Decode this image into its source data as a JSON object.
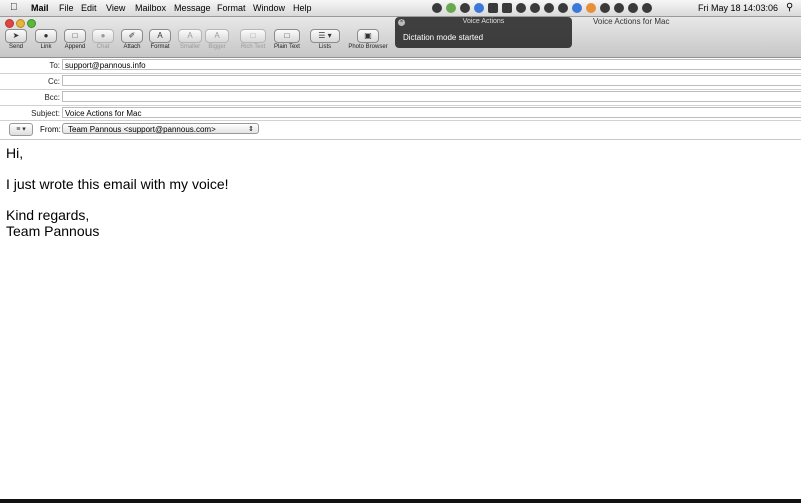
{
  "menubar": {
    "app": "Mail",
    "items": [
      "File",
      "Edit",
      "View",
      "Mailbox",
      "Message",
      "Format",
      "Window",
      "Help"
    ],
    "clock": "Fri May 18  14:03:06"
  },
  "window": {
    "title": "Voice Actions for Mac"
  },
  "toolbar": {
    "buttons": [
      {
        "label": "Send"
      },
      {
        "label": "Link"
      },
      {
        "label": "Append"
      },
      {
        "label": "Chat"
      },
      {
        "label": "Attach"
      },
      {
        "label": "Format"
      },
      {
        "label": "Smaller"
      },
      {
        "label": "Bigger"
      },
      {
        "label": "Rich Text"
      },
      {
        "label": "Plain Text"
      },
      {
        "label": "Lists"
      },
      {
        "label": "Photo Browser"
      }
    ]
  },
  "notification": {
    "title": "Voice Actions",
    "message": "Dictation mode started"
  },
  "fields": {
    "to_label": "To:",
    "to_value": "support@pannous.info",
    "cc_label": "Cc:",
    "cc_value": "",
    "bcc_label": "Bcc:",
    "bcc_value": "",
    "subject_label": "Subject:",
    "subject_value": "Voice Actions for Mac",
    "from_label": "From:",
    "from_value": "Team Pannous <support@pannous.com>"
  },
  "body": {
    "line1": "Hi,",
    "line2": "I just wrote this email with my voice!",
    "line3": "Kind regards,",
    "line4": "Team Pannous"
  }
}
